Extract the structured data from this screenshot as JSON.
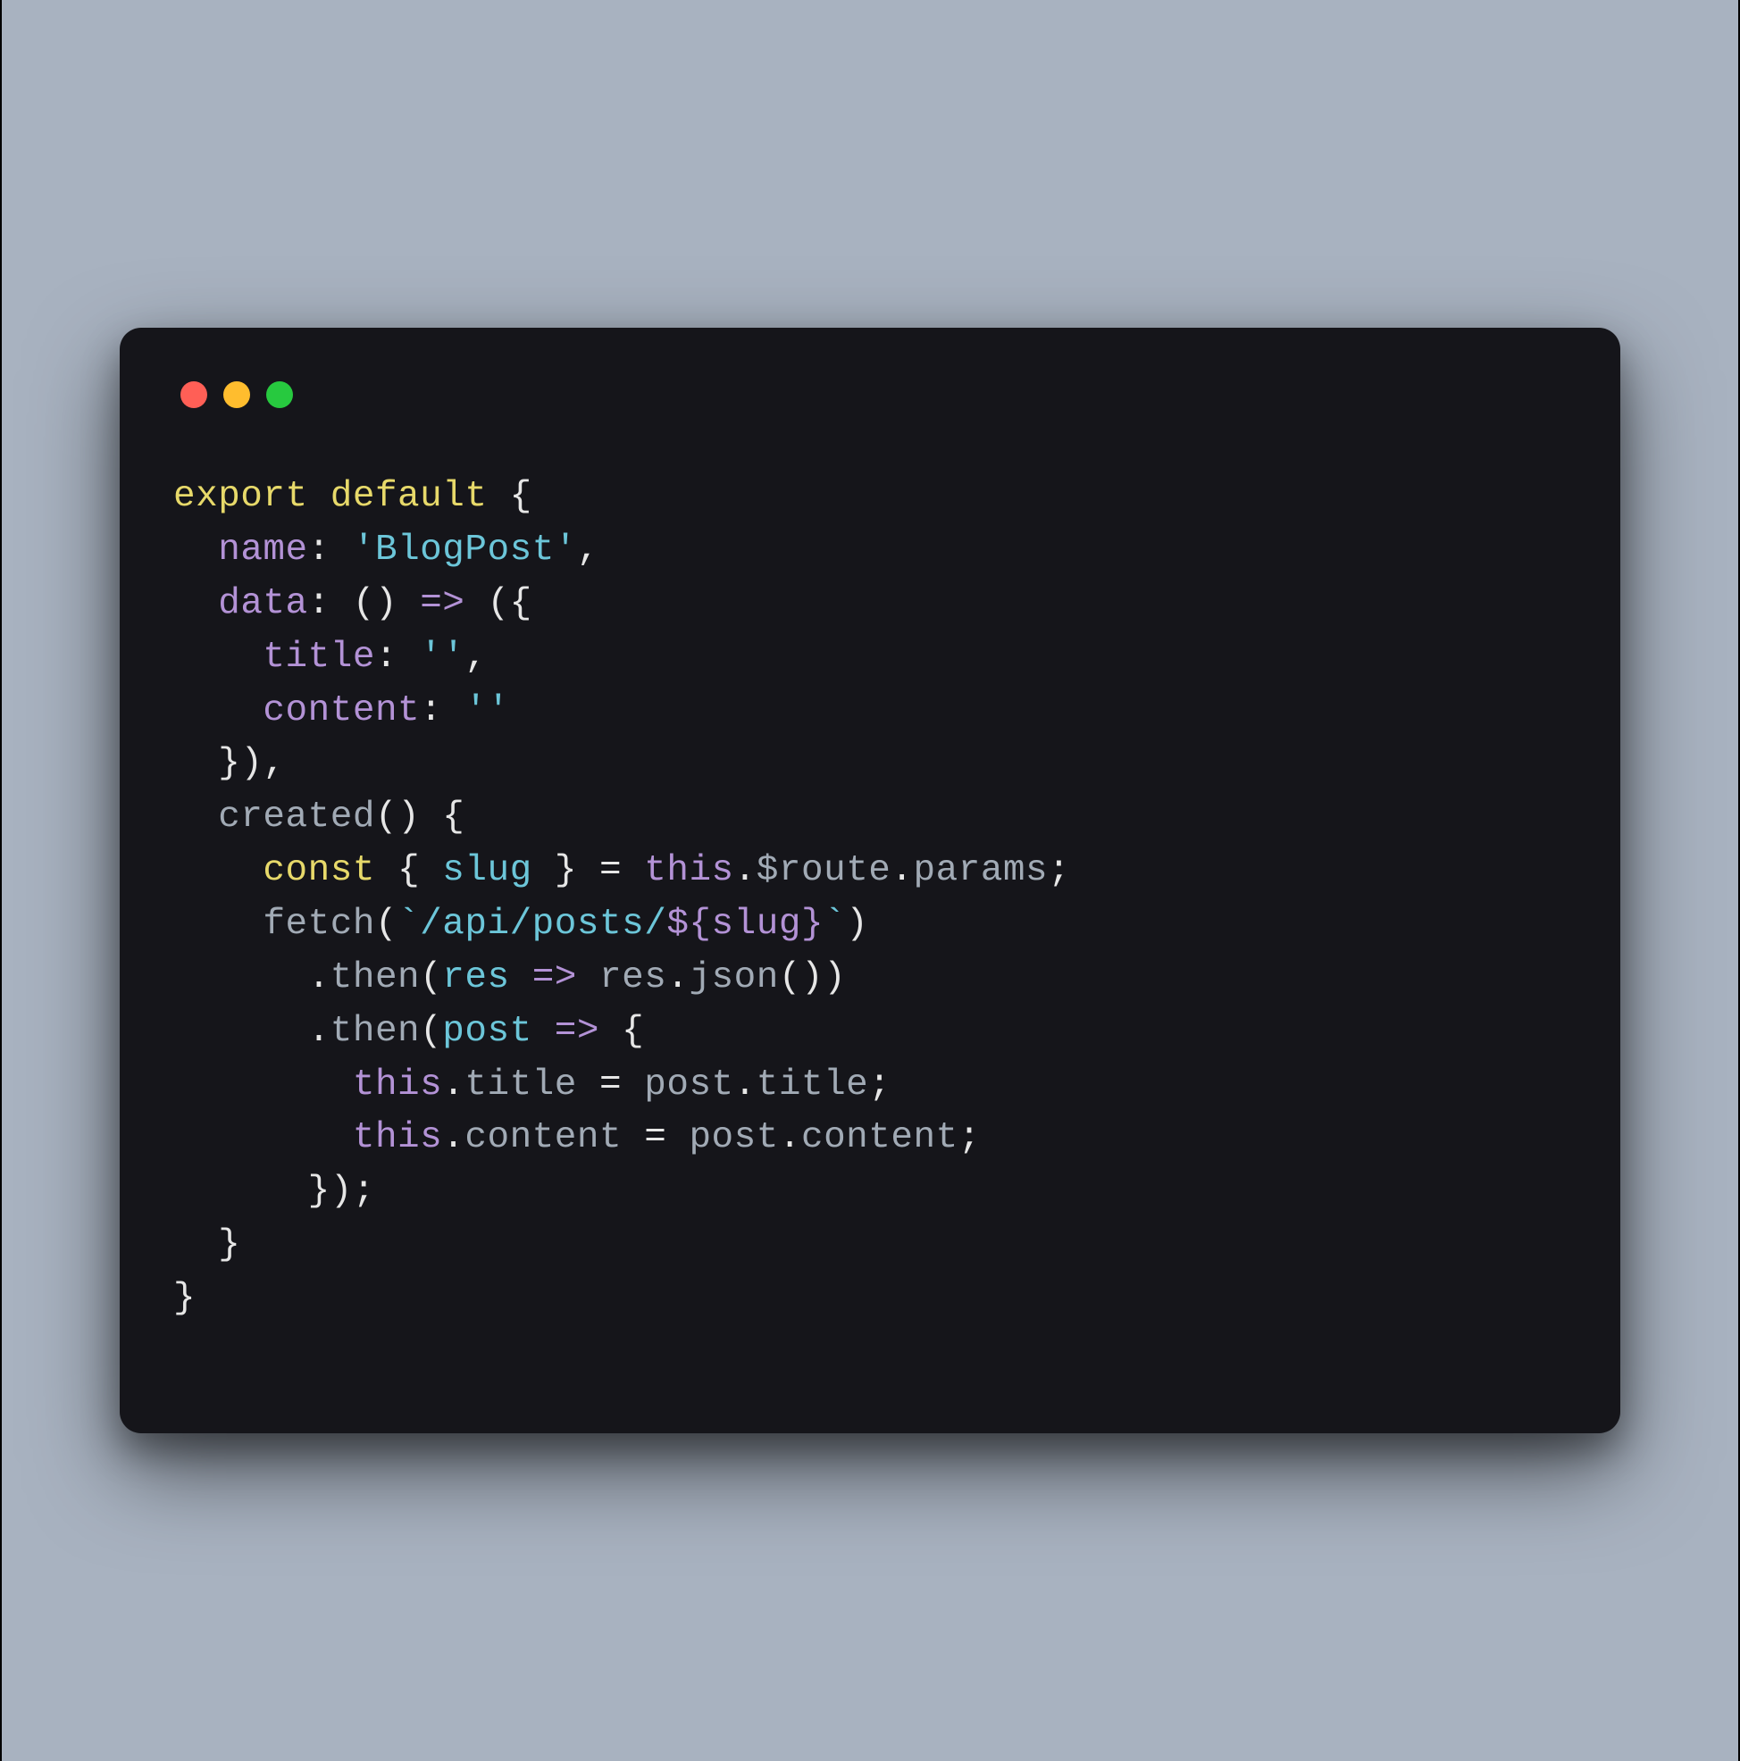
{
  "window": {
    "traffic_lights": {
      "red": "#ff5f56",
      "yellow": "#ffbd2e",
      "green": "#27c93f"
    }
  },
  "code": {
    "tokens": {
      "export": "export",
      "default": "default",
      "const": "const",
      "name_key": "name",
      "name_val": "'BlogPost'",
      "data_key": "data",
      "title_key": "title",
      "content_key": "content",
      "empty_str": "''",
      "created": "created",
      "slug": "slug",
      "this": "this",
      "route": "$route",
      "params": "params",
      "fetch": "fetch",
      "tpl_prefix": "`/api/posts/",
      "tpl_open": "${",
      "tpl_var": "slug",
      "tpl_close": "}",
      "tpl_suffix": "`",
      "then": "then",
      "res": "res",
      "json": "json",
      "post": "post",
      "title_prop": "title",
      "content_prop": "content",
      "arrow": "=>",
      "lbrace": "{",
      "rbrace": "}",
      "lparen": "(",
      "rparen": ")",
      "colon": ":",
      "comma": ",",
      "semi": ";",
      "dot": ".",
      "eq": "="
    }
  }
}
